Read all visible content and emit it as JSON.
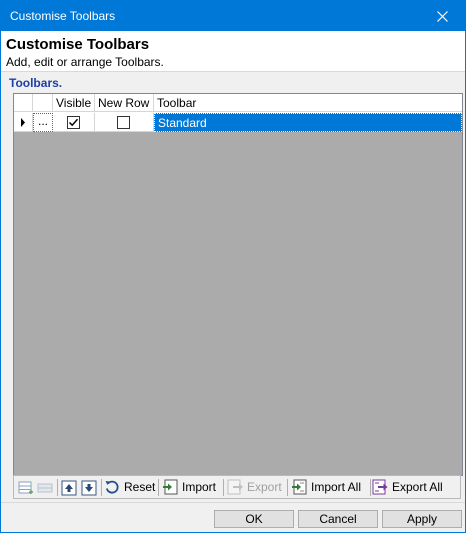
{
  "window": {
    "title": "Customise Toolbars"
  },
  "header": {
    "title": "Customise Toolbars",
    "subtitle": "Add, edit or arrange Toolbars."
  },
  "section": {
    "label": "Toolbars."
  },
  "grid": {
    "columns": [
      "Visible",
      "New Row",
      "Toolbar"
    ],
    "rows": [
      {
        "row_button": "...",
        "visible": true,
        "new_row": false,
        "toolbar": "Standard",
        "selected": true
      }
    ]
  },
  "toolbar": {
    "reset_label": "Reset",
    "import_label": "Import",
    "export_label": "Export",
    "import_all_label": "Import All",
    "export_all_label": "Export All"
  },
  "buttons": {
    "ok": "OK",
    "cancel": "Cancel",
    "apply": "Apply"
  },
  "colors": {
    "accent": "#0078d7",
    "grid_background": "#ababab",
    "section_label": "#1f3fa3",
    "export_all_icon": "#7a3a9a",
    "import_icon": "#2e7d32"
  },
  "icons": {
    "close": "close-icon",
    "row_indicator": "triangle-right-icon",
    "add": "add-row-icon",
    "remove": "remove-row-icon",
    "move_up": "move-up-icon",
    "move_down": "move-down-icon",
    "reset": "reset-icon",
    "import": "import-icon",
    "export": "export-icon",
    "import_all": "import-all-icon",
    "export_all": "export-all-icon"
  }
}
